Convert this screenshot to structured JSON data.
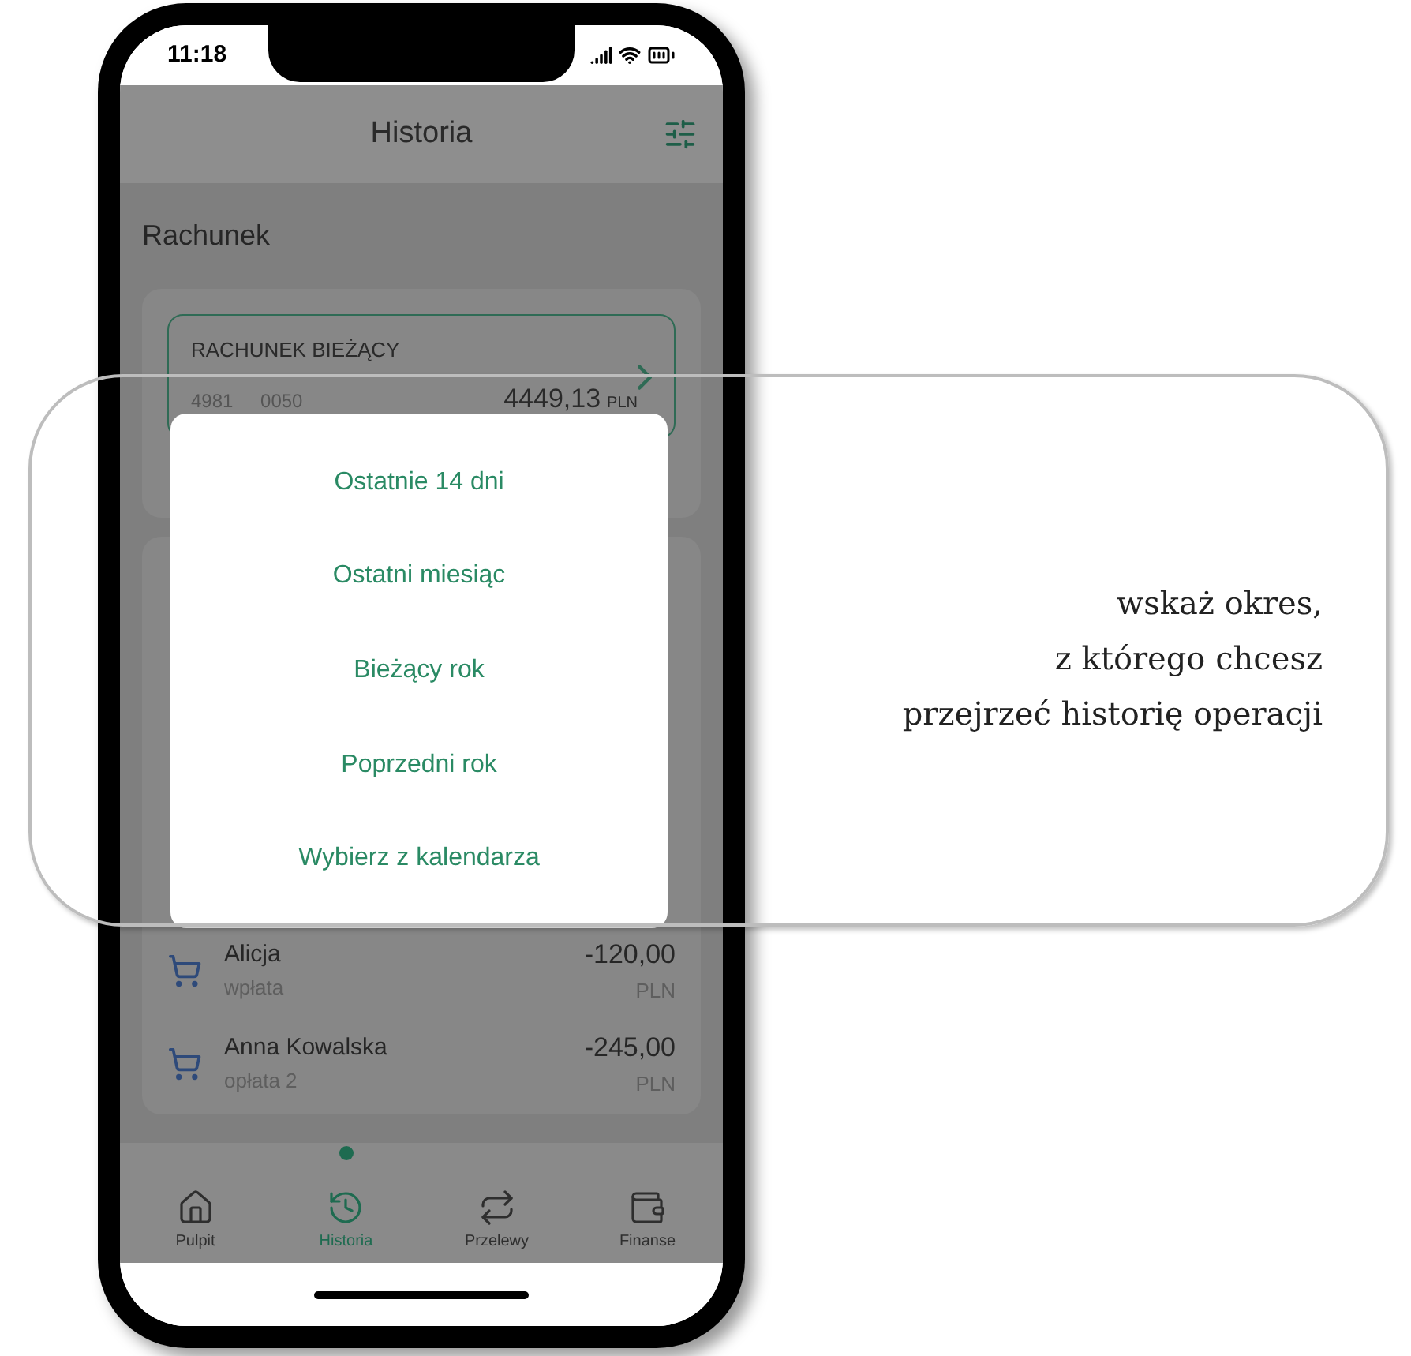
{
  "status_bar": {
    "time": "11:18"
  },
  "header": {
    "title": "Historia"
  },
  "section_title": "Rachunek",
  "account": {
    "name": "RACHUNEK BIEŻĄCY",
    "number": "4981 0050",
    "balance": "4449,13",
    "currency": "PLN"
  },
  "transactions": [
    {
      "name": "Alicja",
      "description": "wpłata",
      "amount": "-120,00",
      "currency": "PLN"
    },
    {
      "name": "Anna Kowalska",
      "description": "opłata 2",
      "amount": "-245,00",
      "currency": "PLN"
    }
  ],
  "period_menu": {
    "options": [
      "Ostatnie 14 dni",
      "Ostatni miesiąc",
      "Bieżący rok",
      "Poprzedni rok",
      "Wybierz z kalendarza"
    ]
  },
  "tab_bar": [
    {
      "label": "Pulpit",
      "kind": "home",
      "selected": false
    },
    {
      "label": "Historia",
      "kind": "history",
      "selected": true
    },
    {
      "label": "Przelewy",
      "kind": "transfers",
      "selected": false
    },
    {
      "label": "Finanse",
      "kind": "wallet",
      "selected": false
    }
  ],
  "callout": {
    "text": "wskaż okres,\nz którego chcesz\nprzejrzeć historię operacji"
  }
}
